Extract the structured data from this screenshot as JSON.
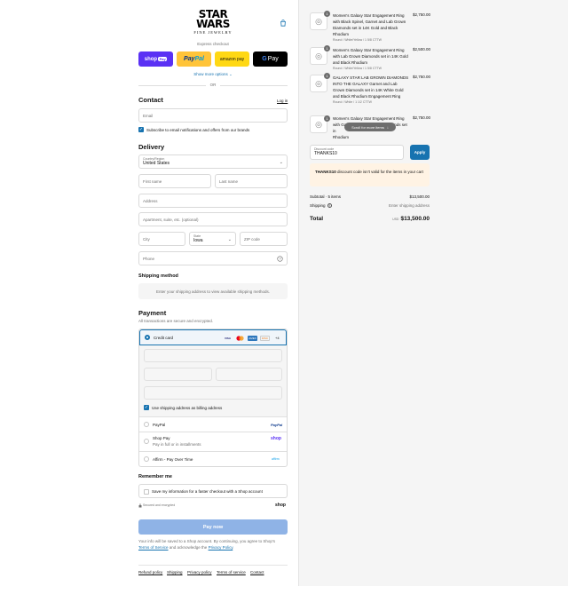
{
  "brand": {
    "logo_line1": "STAR",
    "logo_line2": "WARS",
    "logo_sub": "FINE JEWELRY"
  },
  "express": {
    "label": "Express checkout",
    "shop_pay": "shop",
    "shop_pay_tag": "Pay",
    "paypal_a": "Pay",
    "paypal_b": "Pal",
    "amazon": "amazon pay",
    "gpay_g": "G",
    "gpay": "Pay",
    "show_more": "Show more options",
    "or": "OR"
  },
  "contact": {
    "title": "Contact",
    "login": "Log in",
    "email_placeholder": "Email",
    "subscribe_label": "Subscribe to email notifications and offers from our brands"
  },
  "delivery": {
    "title": "Delivery",
    "country_label": "Country/Region",
    "country_value": "United States",
    "first_name": "First name",
    "last_name": "Last name",
    "address": "Address",
    "apartment": "Apartment, suite, etc. (optional)",
    "city": "City",
    "state_label": "State",
    "state_value": "Iowa",
    "zip": "ZIP code",
    "phone": "Phone"
  },
  "shipping_method": {
    "title": "Shipping method",
    "message": "Enter your shipping address to view available shipping methods."
  },
  "payment": {
    "title": "Payment",
    "subtitle": "All transactions are secure and encrypted.",
    "credit_card": "Credit card",
    "brands": [
      "VISA",
      "MC",
      "AMEX",
      "DISC"
    ],
    "more_brands": "+4",
    "use_shipping": "Use shipping address as billing address",
    "paypal": "PayPal",
    "paypal_logo": "PayPal",
    "shop_pay": "Shop Pay",
    "shop_pay_sub": "Pay in full or in installments",
    "shop_logo": "shop",
    "affirm": "Affirm - Pay Over Time",
    "affirm_logo": "affirm"
  },
  "remember": {
    "title": "Remember me",
    "save_label": "Save my information for a faster checkout with a Shop account",
    "secure": "Secured and encrypted",
    "shop_logo": "shop"
  },
  "pay_now": "Pay now",
  "legal": {
    "line1": "Your info will be saved to a Shop account. By continuing, you agree to Shop's",
    "tos": "Terms of Service",
    "and": " and acknowledge the ",
    "privacy": "Privacy Policy",
    "end": "."
  },
  "footer_links": [
    "Refund policy",
    "Shipping",
    "Privacy policy",
    "Terms of service",
    "Contact"
  ],
  "cart": {
    "items": [
      {
        "qty": "1",
        "name": "Women's Galaxy Star Engagement Ring with Black Spinel, Garnet and Lab Grown Diamonds set in 14K Gold and Black Rhodium",
        "variant": "Round / White/Yellow / 1 5/8 CTTW",
        "price": "$2,750.00"
      },
      {
        "qty": "1",
        "name": "Women's Galaxy Star Engagement Ring with Lab Grown Diamonds set in 14K Gold and Black Rhodium",
        "variant": "Round / White/Yellow / 1 5/8 CTTW",
        "price": "$2,500.00"
      },
      {
        "qty": "1",
        "name": "GALAXY STAR LAB GROWN DIAMONDS INTO THE GALAXY Garnet and Lab Grown Diamonds set in 14K White Gold and Black Rhodium Engagement Ring",
        "variant": "Round / White / 1 1/2 CTTW",
        "price": "$2,750.00"
      },
      {
        "qty": "1",
        "name": "Women's Galaxy Star Engagement Ring with Garnet and Lab Grown Diamonds set in",
        "variant": "",
        "price": "$2,750.00",
        "tail": "Rhodium"
      }
    ],
    "scroll_tip": "Scroll for more items",
    "discount_label": "Discount code",
    "discount_value": "THANKS10",
    "apply": "Apply",
    "warning_code": "THANKS10",
    "warning_text": " discount code isn't valid for the items in your cart",
    "subtotal_label": "Subtotal · 5 items",
    "subtotal_value": "$13,500.00",
    "shipping_label": "Shipping",
    "shipping_value": "Enter shipping address",
    "total_label": "Total",
    "currency": "USD",
    "total_value": "$13,500.00"
  }
}
